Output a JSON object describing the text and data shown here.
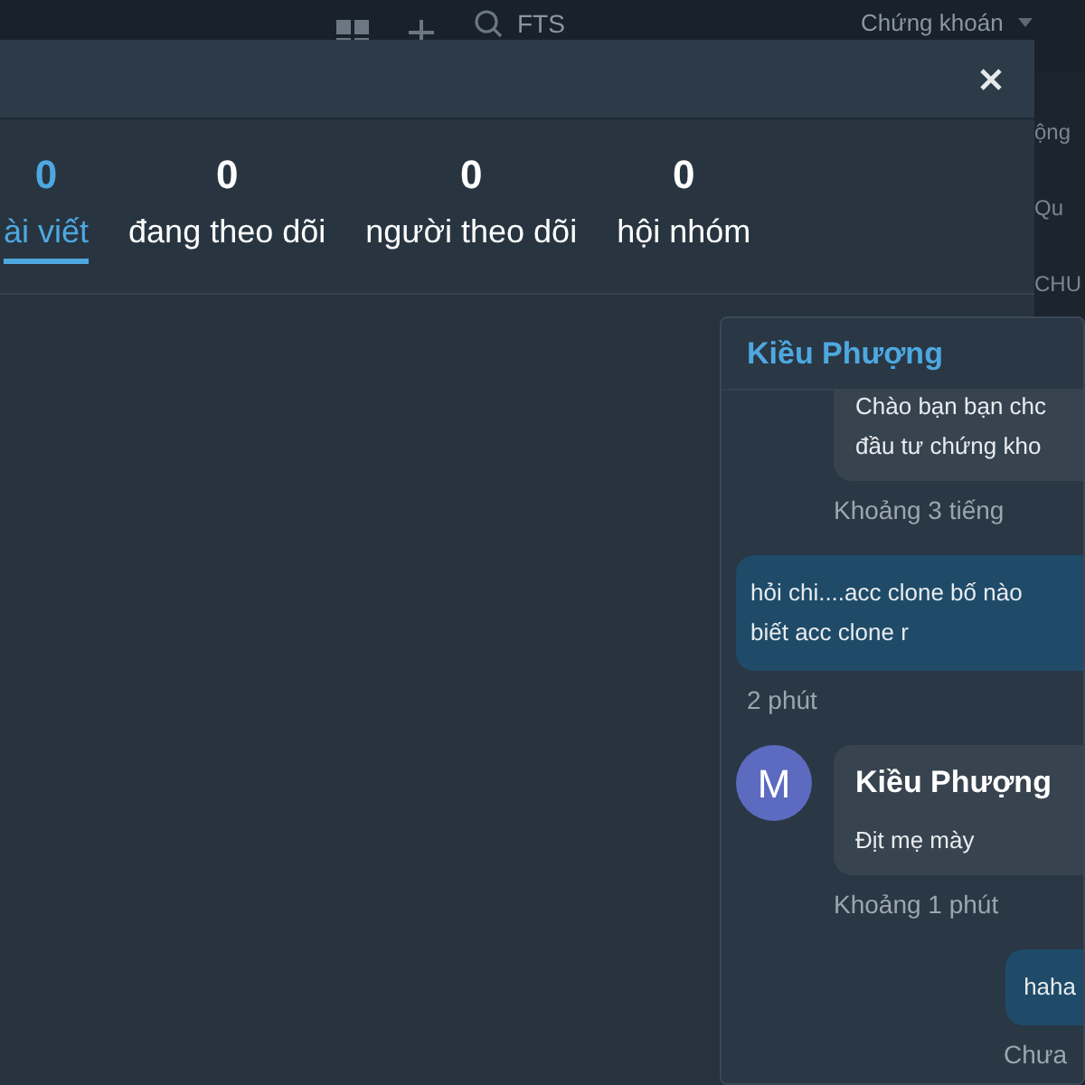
{
  "top_bar": {
    "search_value": "FTS",
    "dropdown": "Chứng khoán"
  },
  "side_labels": [
    "ộng",
    "Qu",
    "CHU"
  ],
  "stats": [
    {
      "count": "0",
      "label": "ài viết",
      "selected": true
    },
    {
      "count": "0",
      "label": "đang theo dõi",
      "selected": false
    },
    {
      "count": "0",
      "label": "người theo dõi",
      "selected": false
    },
    {
      "count": "0",
      "label": "hội nhóm",
      "selected": false
    }
  ],
  "chat": {
    "title": "Kiều Phượng",
    "messages": [
      {
        "kind": "incoming",
        "lines": [
          "Chào bạn bạn chc",
          "đầu tư chứng kho"
        ],
        "time": "Khoảng 3 tiếng"
      },
      {
        "kind": "outgoing",
        "lines": [
          "hỏi chi....acc clone bố nào",
          "biết acc clone r"
        ],
        "time": "2 phút"
      },
      {
        "kind": "incoming",
        "avatar": "M",
        "sender": "Kiều Phượng",
        "lines": [
          "Địt mẹ mày"
        ],
        "time": "Khoảng 1 phút"
      },
      {
        "kind": "outgoing",
        "lines": [
          "haha"
        ],
        "time": "Chưa"
      }
    ]
  }
}
